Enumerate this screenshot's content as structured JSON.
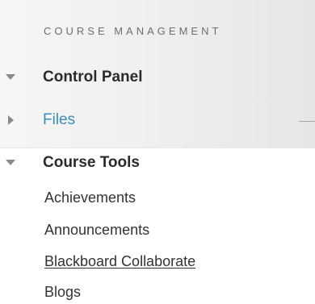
{
  "course_management": {
    "heading": "COURSE MANAGEMENT",
    "control_panel": {
      "label": "Control Panel",
      "state": "expanded"
    },
    "files": {
      "label": "Files",
      "state": "collapsed"
    }
  },
  "course_tools": {
    "label": "Course Tools",
    "state": "expanded",
    "items": [
      {
        "label": "Achievements"
      },
      {
        "label": "Announcements"
      },
      {
        "label": "Blackboard Collaborate",
        "hovered": true
      },
      {
        "label": "Blogs"
      }
    ]
  },
  "colors": {
    "link": "#3a8db8",
    "heading": "#6f6f6f",
    "panel_bg": "#eeeeee"
  }
}
